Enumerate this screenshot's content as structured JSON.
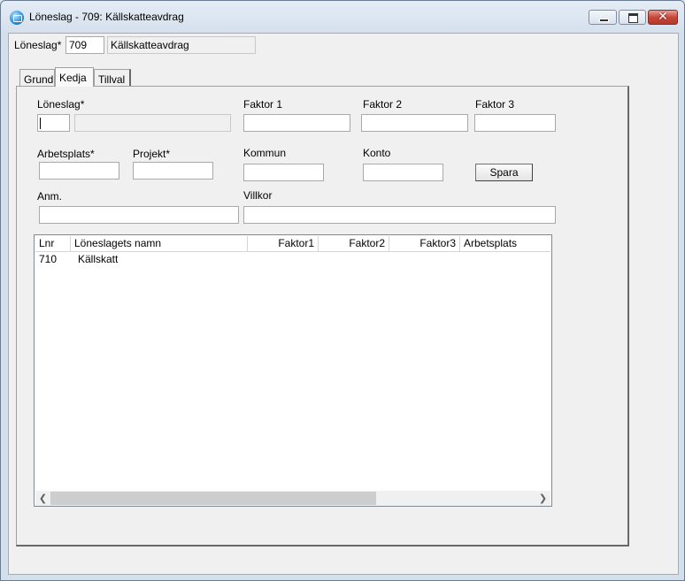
{
  "window": {
    "title": "Löneslag - 709: Källskatteavdrag",
    "icon": "app-icon",
    "controls": {
      "minimize": "minimize-icon",
      "maximize": "maximize-icon",
      "close": "✕"
    }
  },
  "header": {
    "loneslag_label": "Löneslag*",
    "loneslag_value": "709",
    "loneslag_name": "Källskatteavdrag"
  },
  "tabs": [
    {
      "label": "Grund",
      "selected": false
    },
    {
      "label": "Kedja",
      "selected": true
    },
    {
      "label": "Tillval",
      "selected": false
    }
  ],
  "form": {
    "loneslag_label": "Löneslag*",
    "loneslag_value": "",
    "loneslag_name": "",
    "faktor1_label": "Faktor 1",
    "faktor2_label": "Faktor 2",
    "faktor3_label": "Faktor 3",
    "arbetsplats_label": "Arbetsplats*",
    "projekt_label": "Projekt*",
    "kommun_label": "Kommun",
    "konto_label": "Konto",
    "save_label": "Spara",
    "anm_label": "Anm.",
    "villkor_label": "Villkor"
  },
  "list": {
    "columns": [
      "Lnr",
      "Löneslagets namn",
      "Faktor1",
      "Faktor2",
      "Faktor3",
      "Arbetsplats"
    ],
    "rows": [
      {
        "lnr": "710",
        "namn": "Källskatt",
        "faktor1": "",
        "faktor2": "",
        "faktor3": "",
        "arbetsplats": ""
      }
    ],
    "scroll_left": "❮",
    "scroll_right": "❯"
  }
}
